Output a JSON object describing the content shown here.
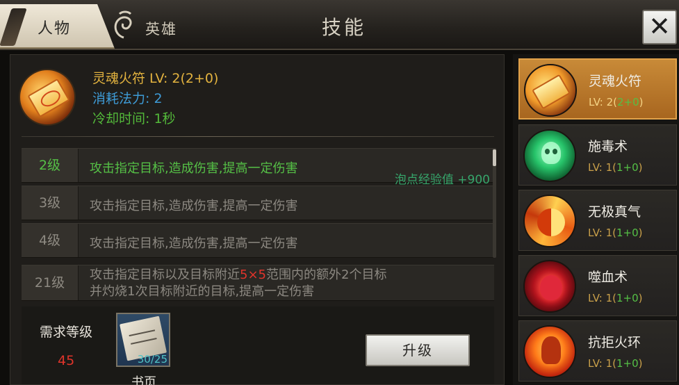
{
  "tabs": {
    "person": "人物",
    "hero": "英雄"
  },
  "title": "技能",
  "close_label": "✕",
  "selected_skill": {
    "name_level": "灵魂火符 LV: 2(2+0)",
    "mana_cost": "消耗法力: 2",
    "cooldown": "冷却时间: 1秒"
  },
  "levels": [
    {
      "level": "2级",
      "desc": "攻击指定目标,造成伤害,提高一定伤害",
      "current": true,
      "exp": "泡点经验值 +900"
    },
    {
      "level": "3级",
      "desc": "攻击指定目标,造成伤害,提高一定伤害"
    },
    {
      "level": "4级",
      "desc": "攻击指定目标,造成伤害,提高一定伤害"
    },
    {
      "level": "21级",
      "desc_line1_pre": "攻击指定目标以及目标附近",
      "desc_line1_red": "5×5",
      "desc_line1_post": "范围内的额外2个目标",
      "desc_line2": "并灼烧1次目标附近的目标,提高一定伤害"
    }
  ],
  "requirement": {
    "label": "需求等级",
    "value": "45"
  },
  "book": {
    "count": "30/25",
    "label": "书页"
  },
  "upgrade_label": "升级",
  "skills": [
    {
      "name": "灵魂火符",
      "lv_prefix": "LV: 2(",
      "lv_green": "2+0",
      "lv_suffix": ")",
      "icon": "soul-talisman-icon"
    },
    {
      "name": "施毒术",
      "lv_prefix": "LV: 1(",
      "lv_green": "1+0",
      "lv_suffix": ")",
      "icon": "poison-skull-icon"
    },
    {
      "name": "无极真气",
      "lv_prefix": "LV: 1(",
      "lv_green": "1+0",
      "lv_suffix": ")",
      "icon": "taiji-icon"
    },
    {
      "name": "噬血术",
      "lv_prefix": "LV: 1(",
      "lv_green": "1+0",
      "lv_suffix": ")",
      "icon": "blood-drop-icon"
    },
    {
      "name": "抗拒火环",
      "lv_prefix": "LV: 1(",
      "lv_green": "1+0",
      "lv_suffix": ")",
      "icon": "fire-ring-icon"
    }
  ]
}
